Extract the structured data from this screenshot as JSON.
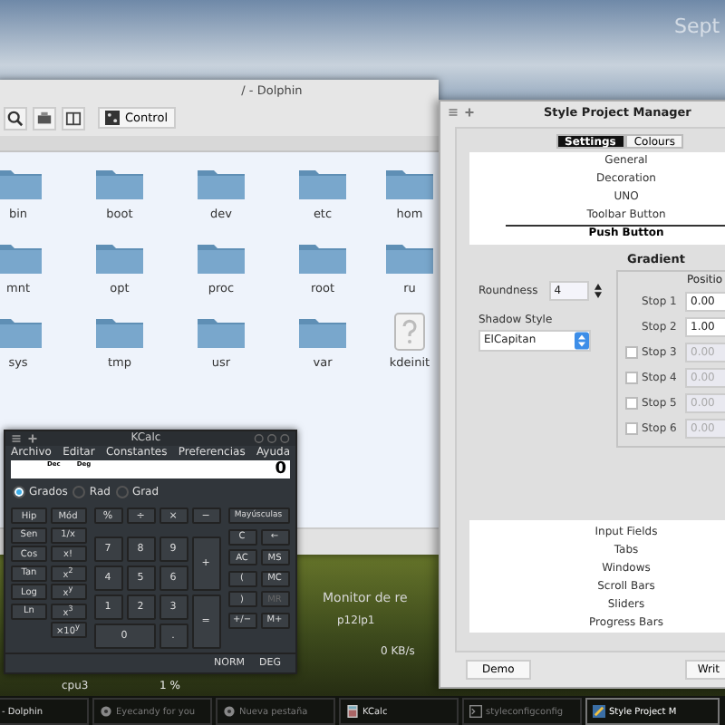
{
  "desktop": {
    "clock": "Sept",
    "monitor": {
      "title": "Monitor de re",
      "device": "p12lp1",
      "rate": "0 KB/s",
      "cpu_label": "cpu3",
      "cpu_value": "1 %"
    }
  },
  "dolphin": {
    "title": "/ - Dolphin",
    "control": "Control",
    "files": [
      {
        "name": "bin",
        "kind": "folder"
      },
      {
        "name": "boot",
        "kind": "folder"
      },
      {
        "name": "dev",
        "kind": "folder"
      },
      {
        "name": "etc",
        "kind": "folder"
      },
      {
        "name": "hom",
        "kind": "folder"
      },
      {
        "name": "mnt",
        "kind": "folder"
      },
      {
        "name": "opt",
        "kind": "folder"
      },
      {
        "name": "proc",
        "kind": "folder"
      },
      {
        "name": "root",
        "kind": "folder"
      },
      {
        "name": "ru",
        "kind": "folder"
      },
      {
        "name": "sys",
        "kind": "folder"
      },
      {
        "name": "tmp",
        "kind": "folder"
      },
      {
        "name": "usr",
        "kind": "folder"
      },
      {
        "name": "var",
        "kind": "folder"
      },
      {
        "name": "kdeinit",
        "kind": "unknown"
      }
    ]
  },
  "kcalc": {
    "title": "KCalc",
    "menu": [
      "Archivo",
      "Editar",
      "Constantes",
      "Preferencias",
      "Ayuda"
    ],
    "display": {
      "base": "Dec",
      "angle": "Deg",
      "value": "0"
    },
    "angle_modes": [
      {
        "label": "Grados",
        "selected": true
      },
      {
        "label": "Rad",
        "selected": false
      },
      {
        "label": "Grad",
        "selected": false
      }
    ],
    "function_keys": [
      "Hip",
      "Mód",
      "Sen",
      "1/x",
      "Cos",
      "x!",
      "Tan",
      "x$^{2}$",
      "Log",
      "x$^{y}$",
      "Ln",
      "x$^{3}$",
      "×10$^{y}$"
    ],
    "number_keys": [
      "%",
      "÷",
      "×",
      "−",
      "7",
      "8",
      "9",
      "+",
      "4",
      "5",
      "6",
      "1",
      "2",
      "3",
      "=",
      "0",
      "."
    ],
    "memory_keys": [
      {
        "label": "Mayúsculas",
        "disabled": false
      },
      {
        "label": "C",
        "disabled": false
      },
      {
        "label": "←",
        "disabled": false
      },
      {
        "label": "AC",
        "disabled": false
      },
      {
        "label": "MS",
        "disabled": false
      },
      {
        "label": "(",
        "disabled": false
      },
      {
        "label": "MC",
        "disabled": false
      },
      {
        "label": ")",
        "disabled": false
      },
      {
        "label": "MR",
        "disabled": true
      },
      {
        "label": "+/−",
        "disabled": false
      },
      {
        "label": "M+",
        "disabled": false
      }
    ],
    "status": [
      "NORM",
      "DEG"
    ]
  },
  "style_manager": {
    "title": "Style Project Manager",
    "tabs": [
      {
        "label": "Settings",
        "selected": true
      },
      {
        "label": "Colours",
        "selected": false
      }
    ],
    "categories": [
      {
        "label": "General",
        "selected": false
      },
      {
        "label": "Decoration",
        "selected": false
      },
      {
        "label": "UNO",
        "selected": false
      },
      {
        "label": "Toolbar Button",
        "selected": false
      },
      {
        "label": "Push Button",
        "selected": true
      }
    ],
    "roundness": {
      "label": "Roundness",
      "value": "4"
    },
    "shadow_style": {
      "label": "Shadow Style",
      "value": "ElCapitan"
    },
    "gradient": {
      "title": "Gradient",
      "column": "Positio",
      "stops": [
        {
          "label": "Stop 1",
          "value": "0.00",
          "kind": "fixed"
        },
        {
          "label": "Stop 2",
          "value": "1.00",
          "kind": "fixed"
        },
        {
          "label": "Stop 3",
          "value": "0.00",
          "kind": "optional",
          "checked": false
        },
        {
          "label": "Stop 4",
          "value": "0.00",
          "kind": "optional",
          "checked": false
        },
        {
          "label": "Stop 5",
          "value": "0.00",
          "kind": "optional",
          "checked": false
        },
        {
          "label": "Stop 6",
          "value": "0.00",
          "kind": "optional",
          "checked": false
        }
      ]
    },
    "sections": [
      "Input Fields",
      "Tabs",
      "Windows",
      "Scroll Bars",
      "Sliders",
      "Progress Bars"
    ],
    "buttons": [
      "Demo",
      "Writ"
    ]
  },
  "taskbar": {
    "tasks": [
      {
        "label": "- Dolphin",
        "kind": "plain",
        "dimmed": false,
        "selected": false
      },
      {
        "label": "Eyecandy for you",
        "kind": "gear",
        "dimmed": true,
        "selected": false
      },
      {
        "label": "Nueva pestaña",
        "kind": "gear",
        "dimmed": true,
        "selected": false
      },
      {
        "label": "KCalc",
        "kind": "calc",
        "dimmed": false,
        "selected": false
      },
      {
        "label": "styleconfigconfig",
        "kind": "terminal",
        "dimmed": true,
        "selected": false
      },
      {
        "label": "Style Project M",
        "kind": "app",
        "dimmed": false,
        "selected": true
      }
    ]
  }
}
